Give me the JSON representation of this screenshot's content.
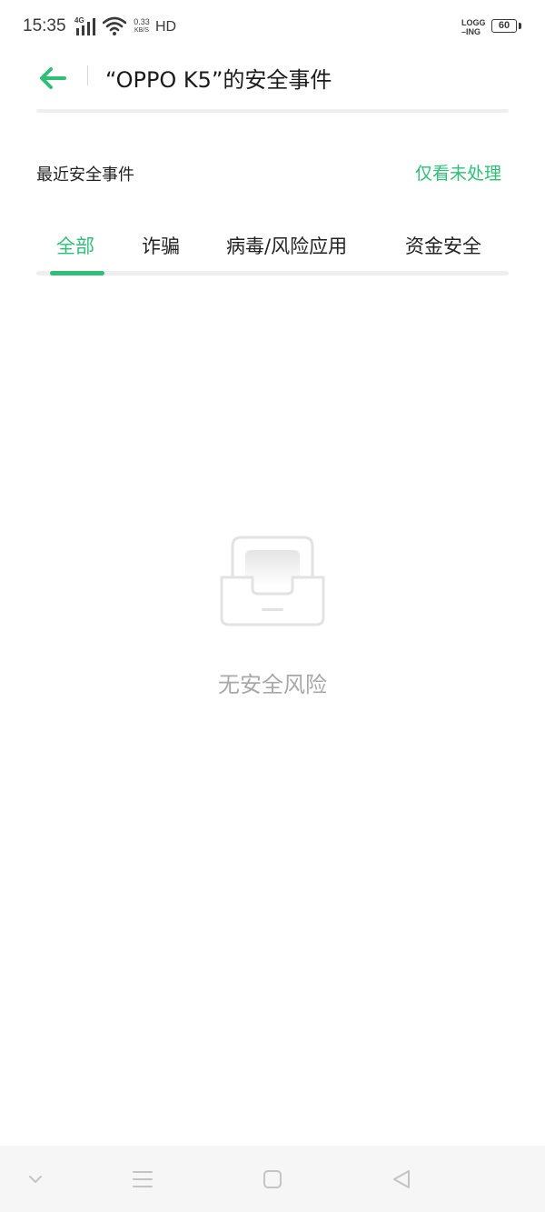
{
  "status_bar": {
    "time": "15:35",
    "network": "4G",
    "speed_value": "0.33",
    "speed_unit": "KB/S",
    "hd": "HD",
    "logging_line1": "LOGG",
    "logging_line2": "–ING",
    "battery": "60"
  },
  "header": {
    "title": "“OPPO K5”的安全事件",
    "back_icon": "arrow-left-icon"
  },
  "section": {
    "title": "最近安全事件",
    "filter_label": "仅看未处理"
  },
  "tabs": [
    {
      "label": "全部",
      "active": true
    },
    {
      "label": "诈骗",
      "active": false
    },
    {
      "label": "病毒/风险应用",
      "active": false
    },
    {
      "label": "资金安全",
      "active": false
    }
  ],
  "empty_state": {
    "icon": "empty-inbox-icon",
    "message": "无安全风险"
  },
  "nav_bar": {
    "items": [
      "chevron-down-icon",
      "menu-icon",
      "home-square-icon",
      "back-triangle-icon"
    ]
  },
  "colors": {
    "accent": "#2fbf77",
    "text_primary": "#1a1a1a",
    "text_muted": "#a8a8a8"
  }
}
